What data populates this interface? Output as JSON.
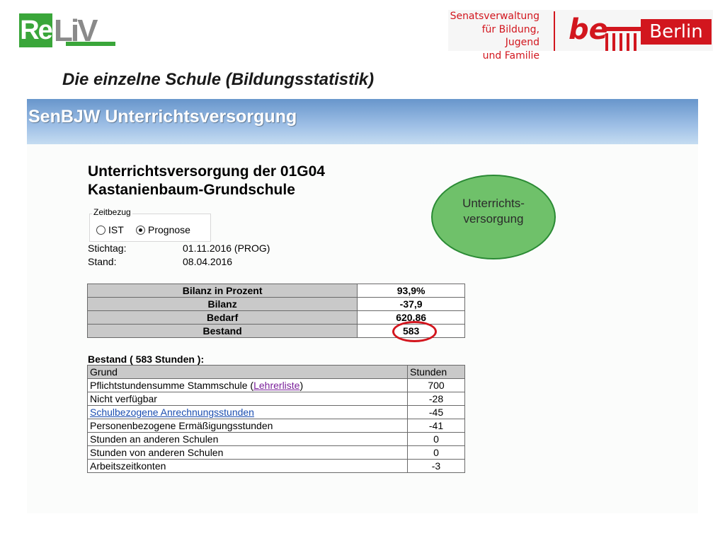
{
  "logos": {
    "reliv_re": "Re",
    "reliv_liv": "LiV",
    "senat_lines": [
      "Senatsverwaltung",
      "für Bildung, Jugend",
      "und Familie"
    ],
    "be_mark": "be",
    "berlin": "Berlin"
  },
  "slide_title": "Die einzelne Schule  (Bildungsstatistik)",
  "app_header": "SenBJW Unterrichtsversorgung",
  "school": {
    "title_line1": "Unterrichtsversorgung der 01G04",
    "title_line2": "Kastanienbaum-Grundschule"
  },
  "zeitbezug": {
    "legend": "Zeitbezug",
    "options": [
      "IST",
      "Prognose"
    ],
    "selected": "Prognose"
  },
  "meta": {
    "stichtag_label": "Stichtag:",
    "stichtag_value": "01.11.2016 (PROG)",
    "stand_label": "Stand:",
    "stand_value": "08.04.2016"
  },
  "bilanz_table": [
    {
      "label": "Bilanz in Prozent",
      "value": "93,9%"
    },
    {
      "label": "Bilanz",
      "value": "-37,9"
    },
    {
      "label": "Bedarf",
      "value": "620,86"
    },
    {
      "label": "Bestand",
      "value": "583"
    }
  ],
  "bestand": {
    "caption": "Bestand ( 583 Stunden ):",
    "headers": [
      "Grund",
      "Stunden"
    ],
    "rows": [
      {
        "pre": "Pflichtstundensumme Stammschule (",
        "link": "Lehrerliste",
        "post": ")",
        "value": "700"
      },
      {
        "label": "Nicht verfügbar",
        "value": "-28"
      },
      {
        "link_label": "Schulbezogene Anrechnungsstunden",
        "value": "-45"
      },
      {
        "label": "Personenbezogene Ermäßigungsstunden",
        "value": "-41"
      },
      {
        "label": "Stunden an anderen Schulen",
        "value": "0"
      },
      {
        "label": "Stunden von anderen Schulen",
        "value": "0"
      },
      {
        "label": "Arbeitszeitkonten",
        "value": "-3"
      }
    ]
  },
  "callout": {
    "line1": "Unterrichts-",
    "line2": "versorgung"
  },
  "colors": {
    "accent_green": "#3aa63a",
    "berlin_red": "#d2161e",
    "header_blue": "#6896cc",
    "callout_green": "#6fc16a"
  }
}
